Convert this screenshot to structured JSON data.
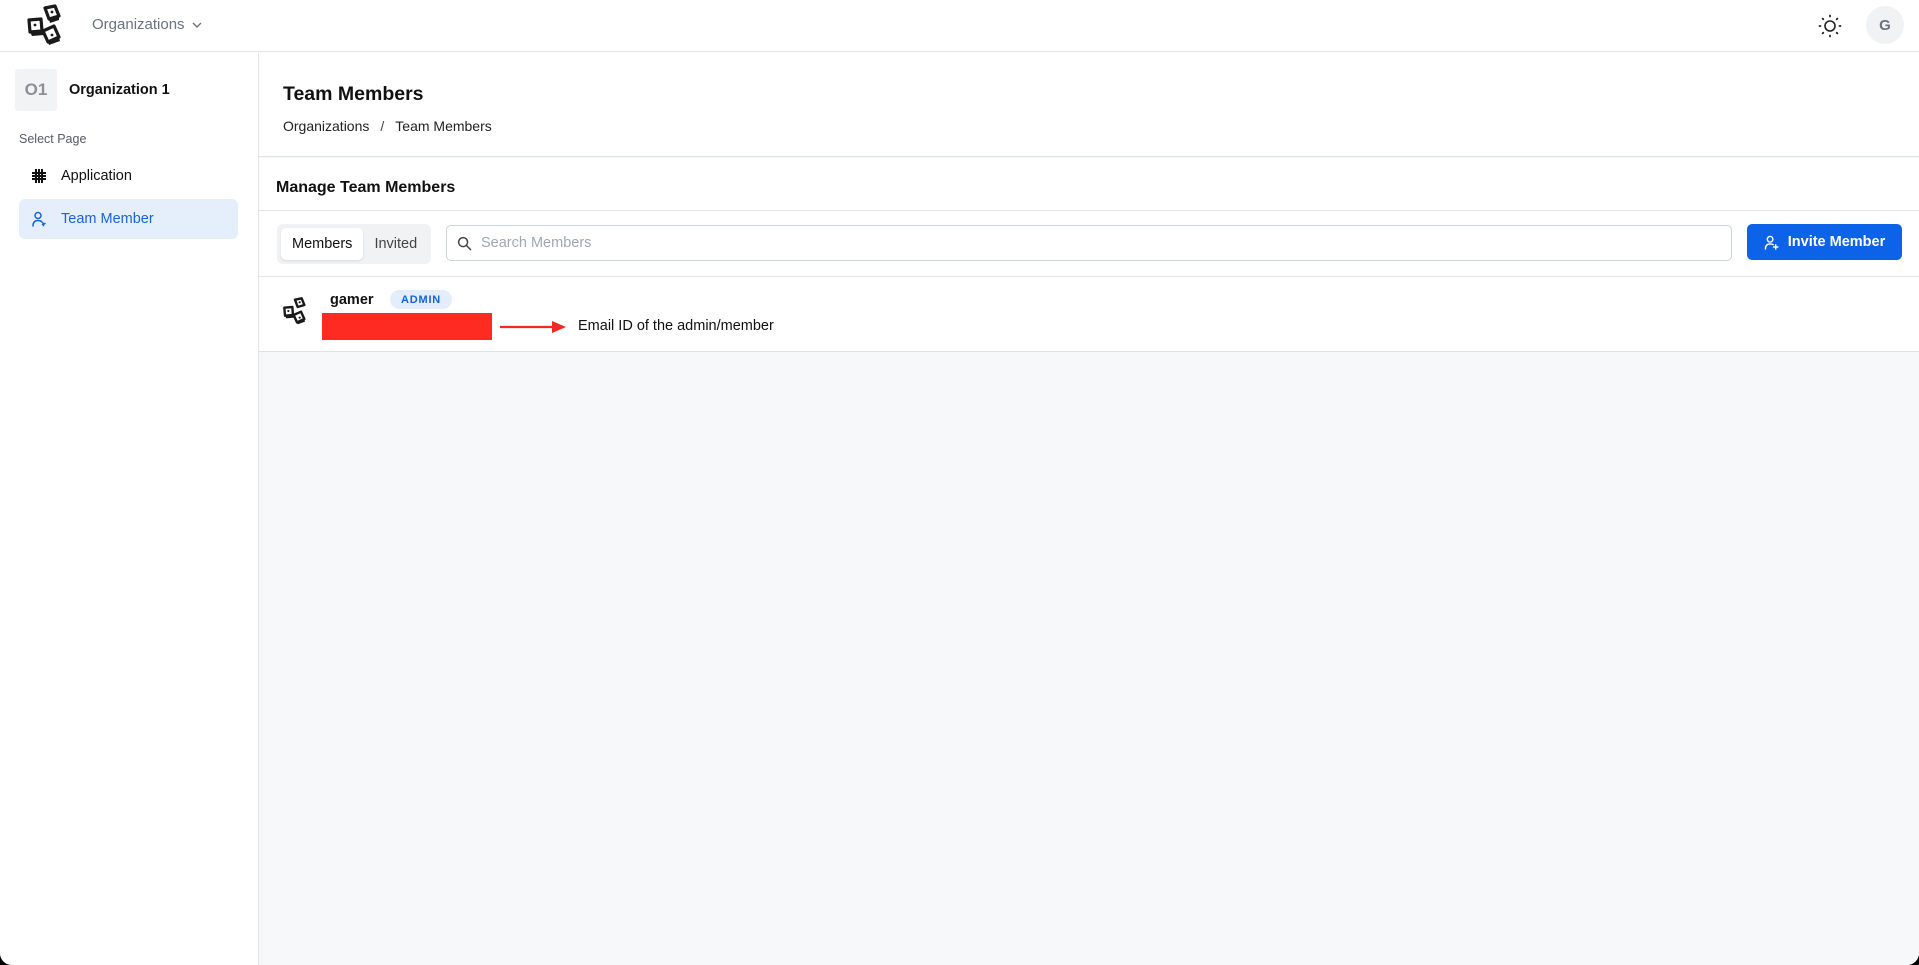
{
  "header": {
    "logo_icon": "keycaps-logo-icon",
    "org_switcher_label": "Organizations",
    "theme_icon": "sun-icon",
    "user_avatar_initial": "G"
  },
  "sidebar": {
    "org_badge": "O1",
    "org_name": "Organization 1",
    "section_label": "Select Page",
    "items": [
      {
        "label": "Application",
        "icon": "grid-icon",
        "active": false
      },
      {
        "label": "Team Member",
        "icon": "user-icon",
        "active": true
      }
    ]
  },
  "page": {
    "title": "Team Members",
    "breadcrumb": [
      "Organizations",
      "Team Members"
    ],
    "breadcrumb_separator": "/"
  },
  "card": {
    "title": "Manage Team Members",
    "tabs": [
      {
        "label": "Members",
        "active": true
      },
      {
        "label": "Invited",
        "active": false
      }
    ],
    "search": {
      "placeholder": "Search Members",
      "value": ""
    },
    "invite_button_label": "Invite Member",
    "members": [
      {
        "name": "gamer",
        "role": "ADMIN",
        "email": "[redacted]"
      }
    ]
  },
  "annotation": {
    "text": "Email ID of the admin/member",
    "redaction_color": "#fe2b22"
  },
  "colors": {
    "accent": "#0c63e7",
    "active_nav_bg": "#e5eefb",
    "active_nav_text": "#1d63d6",
    "badge_bg": "#e3edfb"
  }
}
